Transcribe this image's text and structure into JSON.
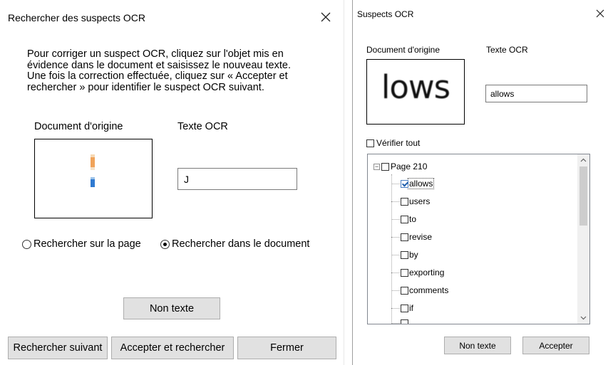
{
  "dialog1": {
    "title": "Rechercher des suspects OCR",
    "instructions": "Pour corriger un suspect OCR, cliquez sur l'objet mis en évidence dans le document et saisissez le nouveau texte. Une fois la correction effectuée, cliquez sur « Accepter et rechercher » pour identifier le suspect OCR suivant.",
    "original_label": "Document d'origine",
    "ocr_label": "Texte OCR",
    "ocr_value": "J",
    "radio_page": "Rechercher sur la page",
    "radio_document": "Rechercher dans le document",
    "selected_radio": "document",
    "non_text_button": "Non texte",
    "find_next_button": "Rechercher suivant",
    "accept_find_button": "Accepter et rechercher",
    "close_button": "Fermer"
  },
  "dialog2": {
    "title": "Suspects OCR",
    "original_label": "Document d'origine",
    "ocr_label": "Texte OCR",
    "image_word": "lows",
    "ocr_value": "allows",
    "verify_all_label": "Vérifier tout",
    "tree": {
      "page_label": "Page 210",
      "items": [
        {
          "label": "allows",
          "checked": true
        },
        {
          "label": "users",
          "checked": false
        },
        {
          "label": "to",
          "checked": false
        },
        {
          "label": "revise",
          "checked": false
        },
        {
          "label": "by",
          "checked": false
        },
        {
          "label": "exporting",
          "checked": false
        },
        {
          "label": "comments",
          "checked": false
        },
        {
          "label": "if",
          "checked": false
        }
      ]
    },
    "non_text_button": "Non texte",
    "accept_button": "Accepter"
  },
  "icons": {
    "close": "close-icon",
    "expander": "collapse-minus-icon",
    "scroll_up": "chevron-up-icon",
    "scroll_down": "chevron-down-icon"
  },
  "colors": {
    "button_bg": "#e1e1e1",
    "button_border": "#adadad",
    "scrollbar_track": "#f0f0f0",
    "scrollbar_thumb": "#cdcdcd",
    "check_blue": "#1f5fad"
  }
}
